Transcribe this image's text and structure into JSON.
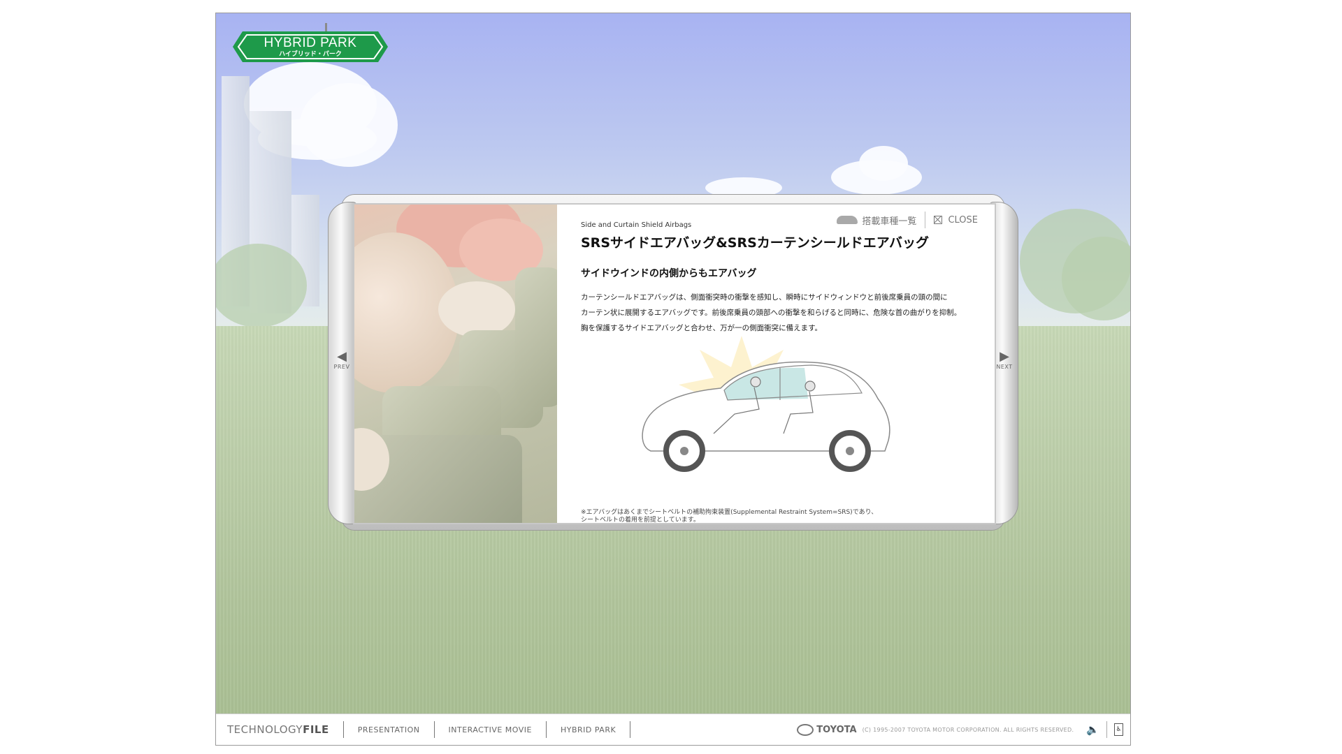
{
  "logo": {
    "title": "HYBRID PARK",
    "subtitle": "ハイブリッド・パーク"
  },
  "modal": {
    "car_list_link": "搭載車種一覧",
    "close_label": "CLOSE",
    "english_subtitle": "Side and Curtain Shield Airbags",
    "title": "SRSサイドエアバッグ&SRSカーテンシールドエアバッグ",
    "subtitle": "サイドウインドの内側からもエアバッグ",
    "body_lines": [
      "カーテンシールドエアバッグは、側面衝突時の衝撃を感知し、瞬時にサイドウィンドウと前後席乗員の頭の間に",
      "カーテン状に展開するエアバッグです。前後席乗員の頭部への衝撃を和らげると同時に、危険な首の曲がりを抑制。",
      "胸を保護するサイドエアバッグと合わせ、万が一の側面衝突に備えます。"
    ],
    "note_lines": [
      "※エアバッグはあくまでシートベルトの補助拘束装置(Supplemental Restraint System=SRS)であり、",
      "シートベルトの着用を前提としています。"
    ],
    "prev_label": "PREV",
    "next_label": "NEXT"
  },
  "footer": {
    "brand_light": "TECHNOLOGY",
    "brand_bold": "FILE",
    "links": [
      "PRESENTATION",
      "INTERACTIVE MOVIE",
      "HYBRID PARK"
    ],
    "maker": "TOYOTA",
    "copyright": "(C) 1995-2007 TOYOTA MOTOR CORPORATION. ALL RIGHTS RESERVED."
  },
  "colors": {
    "logo_green": "#1e9a4a",
    "sky": "#a8b3f2",
    "grass": "#bccea9"
  },
  "icons": [
    "car-icon",
    "close-icon",
    "prev-arrow-icon",
    "next-arrow-icon",
    "speaker-icon",
    "accessibility-icon",
    "toyota-logo-icon"
  ]
}
